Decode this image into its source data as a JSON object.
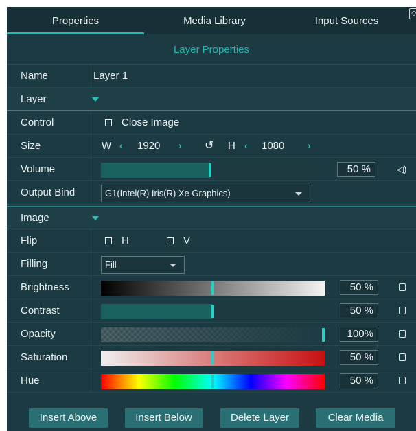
{
  "tabs": [
    {
      "label": "Properties",
      "active": true
    },
    {
      "label": "Media Library",
      "active": false
    },
    {
      "label": "Input Sources",
      "active": false
    }
  ],
  "section_title": "Layer Properties",
  "name": {
    "label": "Name",
    "value": "Layer 1"
  },
  "layer_group": {
    "label": "Layer"
  },
  "control": {
    "label": "Control",
    "option": "Close Image",
    "checked": false
  },
  "size": {
    "label": "Size",
    "w_label": "W",
    "w_value": "1920",
    "h_label": "H",
    "h_value": "1080",
    "link_icon": "link-icon"
  },
  "volume": {
    "label": "Volume",
    "value": 50,
    "display": "50 %",
    "icon": "speaker-icon"
  },
  "output_bind": {
    "label": "Output Bind",
    "value": "G1(Intel(R) Iris(R) Xe Graphics)"
  },
  "image_group": {
    "label": "Image"
  },
  "flip": {
    "label": "Flip",
    "h_label": "H",
    "v_label": "V",
    "h_checked": false,
    "v_checked": false
  },
  "filling": {
    "label": "Filling",
    "value": "Fill"
  },
  "sliders": [
    {
      "key": "brightness",
      "label": "Brightness",
      "value": 50,
      "display": "50 %"
    },
    {
      "key": "contrast",
      "label": "Contrast",
      "value": 50,
      "display": "50 %"
    },
    {
      "key": "opacity",
      "label": "Opacity",
      "value": 100,
      "display": "100%"
    },
    {
      "key": "saturation",
      "label": "Saturation",
      "value": 50,
      "display": "50 %"
    },
    {
      "key": "hue",
      "label": "Hue",
      "value": 50,
      "display": "50 %"
    }
  ],
  "buttons": {
    "insert_above": "Insert Above",
    "insert_below": "Insert Below",
    "delete_layer": "Delete Layer",
    "clear_media": "Clear Media"
  },
  "colors": {
    "accent": "#21b8b0",
    "panel": "#1c3a42",
    "fill": "#19625f"
  }
}
